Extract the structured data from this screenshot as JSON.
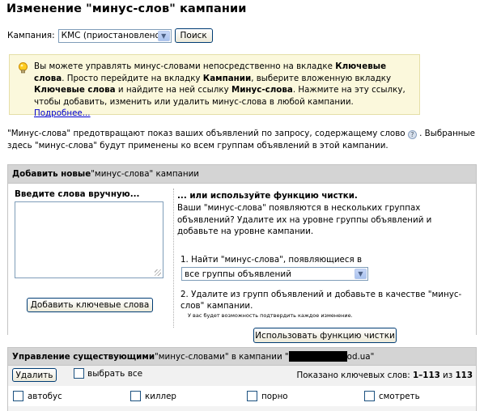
{
  "header": {
    "title": "Изменение \"минус-слов\" кампании"
  },
  "campaign_row": {
    "label": "Кампания:",
    "selected": "КМС (приостановлено)",
    "search_button": "Поиск"
  },
  "tip": {
    "p1": "Вы можете управлять минус-словами непосредственно на вкладке ",
    "b1": "Ключевые слова",
    "p2": ". Просто перейдите на вкладку ",
    "b2": "Кампании",
    "p3": ", выберите вложенную вкладку ",
    "b3": "Ключевые слова",
    "p4": " и найдите на ней ссылку ",
    "b4": "Минус-слова",
    "p5": ". Нажмите на эту ссылку, чтобы добавить, изменить или удалить минус-слова в любой кампании. ",
    "link": "Подробнее..."
  },
  "intro": {
    "part1": "\"Минус-слова\" предотвращают показ ваших объявлений по запросу, содержащему слово",
    "part2": ". Выбранные здесь \"минус-слова\" будут применены ко всем группам объявлений в этой кампании."
  },
  "add_panel": {
    "head_bold": "Добавить новые",
    "head_rest": " \"минус-слова\" кампании",
    "manual_title": "Введите слова вручную...",
    "add_button": "Добавить ключевые слова",
    "clean_title": "... или используйте функцию чистки.",
    "clean_desc": "Ваши \"минус-слова\" появляются в нескольких группах объявлений? Удалите их на уровне группы объявлений и добавьте на уровне кампании.",
    "step1": "1. Найти \"минус-слова\", появляющиеся в",
    "step1_select": "все группы объявлений",
    "step2": "2. Удалите из групп объявлений и добавьте в качестве \"минус-слов\" кампании.",
    "step2_note": "У вас будет возможность подтвердить каждое изменение.",
    "clean_button": "Использовать функцию чистки"
  },
  "manage_panel": {
    "head_bold": "Управление существующими",
    "head_mid": " \"минус-словами\" в кампании \"",
    "head_domain": "od.ua",
    "head_end": "\"",
    "delete_button": "Удалить",
    "select_all": "выбрать все",
    "shown_prefix": "Показано ключевых слов: ",
    "shown_range": "1–113",
    "shown_of": " из ",
    "shown_total": "113",
    "keywords": [
      "автобус",
      "киллер",
      "порно",
      "смотреть"
    ]
  },
  "colors": {
    "tip_bg": "#fbf8dc",
    "link": "#0000cc",
    "panel_head": "#d4d4d4"
  }
}
